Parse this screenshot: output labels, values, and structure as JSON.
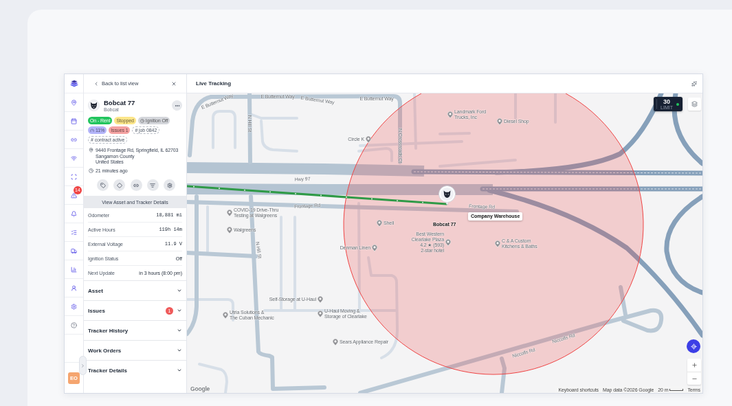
{
  "rail": {
    "alert_badge": "14",
    "user_initials": "EO"
  },
  "panel": {
    "back_link": "Back to list view",
    "asset": {
      "name": "Bobcat 77",
      "type": "Bobcat"
    },
    "tags": [
      {
        "label": "On - Rent",
        "kind": "plain",
        "color": "#22c55e"
      },
      {
        "label": "Stopped",
        "kind": "plain",
        "color": "#fde68a"
      },
      {
        "label": "Ignition Off",
        "kind": "ignition",
        "color": "#d4d6db"
      },
      {
        "label": "11%",
        "kind": "battery",
        "color": "#b4b5fa"
      },
      {
        "label": "Issues 1",
        "kind": "plain",
        "color": "#f5a3a3"
      },
      {
        "label": "# job 0842",
        "kind": "dashed"
      },
      {
        "label": "# contract active",
        "kind": "dashed"
      }
    ],
    "address": [
      "9440 Frontage Rd, Springfield, IL 62703",
      "Sangamon County",
      "United States"
    ],
    "last_update": "21 minutes ago",
    "details_button": "View Asset and Tracker Details",
    "stats": [
      {
        "label": "Odometer",
        "value": "18,881 mi",
        "kind": "mono"
      },
      {
        "label": "Active Hours",
        "value": "119h 14m",
        "kind": "mono"
      },
      {
        "label": "External Voltage",
        "value": "11.9 V",
        "kind": "mono"
      },
      {
        "label": "Ignition Status",
        "value": "Off",
        "kind": "text"
      },
      {
        "label": "Next Update",
        "value": "in 3 hours (8:00 pm)",
        "kind": "text"
      }
    ],
    "sections": [
      {
        "title": "Asset",
        "expanded": false
      },
      {
        "title": "Issues",
        "badge": "1",
        "expanded": false
      },
      {
        "title": "Tracker History",
        "expanded": false
      },
      {
        "title": "Work Orders",
        "expanded": false
      },
      {
        "title": "Tracker Details",
        "expanded": false
      }
    ]
  },
  "map": {
    "title": "Live Tracking",
    "speed_limit": {
      "value": "30",
      "label": "LIMIT"
    },
    "streets": [
      "E Butternut Way",
      "E Butternut Way",
      "E Butternut Way",
      "E Butternut Way",
      "N Hill St",
      "N Crossroads Ct",
      "Hwy 97",
      "Frontage Rd",
      "Frontage Rd",
      "N Hill St",
      "Niccolls Rd",
      "Niccolls Rd"
    ],
    "places": [
      {
        "lines": [
          "Landmark Ford",
          "Trucks, Inc"
        ]
      },
      {
        "lines": [
          "Diesel Shop"
        ]
      },
      {
        "lines": [
          "Circle K"
        ]
      },
      {
        "lines": [
          "COVID-19 Drive-Thru",
          "Testing at Walgreens"
        ]
      },
      {
        "lines": [
          "Shell"
        ]
      },
      {
        "lines": [
          "Walgreens"
        ]
      },
      {
        "lines": [
          "Denman Linen"
        ]
      },
      {
        "lines": [
          "Best Western",
          "Clearlake Plaza"
        ],
        "rating": "4.2 ★ (593)",
        "category": "2-star hotel"
      },
      {
        "lines": [
          "C & A Custom",
          "Kitchens & Baths"
        ]
      },
      {
        "lines": [
          "Self-Storage at U-Haul"
        ]
      },
      {
        "lines": [
          "Utria Solutions &",
          "The Cuban Mechanic"
        ]
      },
      {
        "lines": [
          "U-Haul Moving &",
          "Storage of Clearlake"
        ]
      },
      {
        "lines": [
          "Sears Appliance Repair"
        ]
      }
    ],
    "vehicle": {
      "name": "Bobcat 77",
      "location": "Company Warehouse"
    },
    "logo": "Google",
    "attribution": [
      "Keyboard shortcuts",
      "Map data ©2026 Google",
      "20 m",
      "Terms"
    ]
  }
}
